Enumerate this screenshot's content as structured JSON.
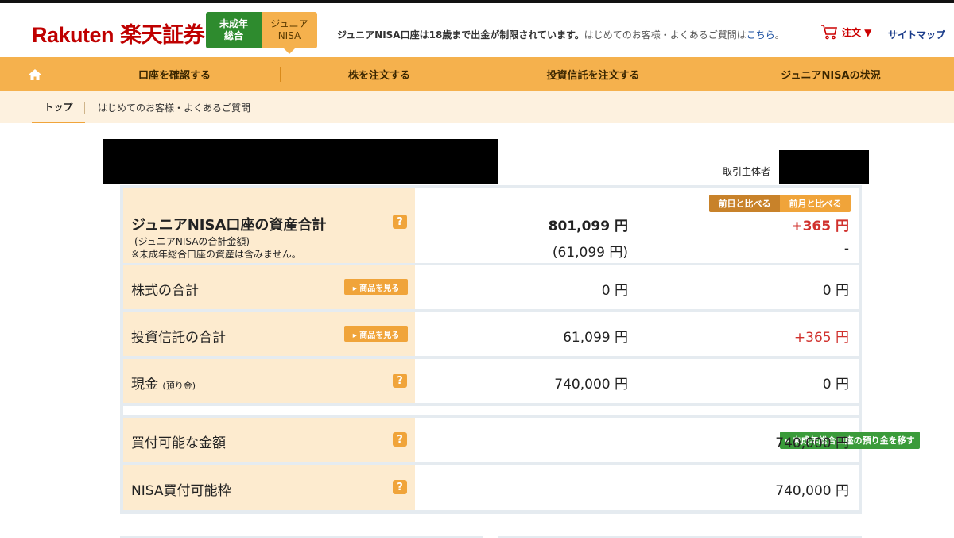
{
  "header": {
    "logo_en": "Rakuten",
    "logo_ja": "楽天証券",
    "tabs": [
      {
        "line1": "未成年",
        "line2": "総合"
      },
      {
        "line1": "ジュニア",
        "line2": "NISA"
      }
    ],
    "notice_bold": "ジュニアNISA口座は18歳まで出金が制限されています。",
    "notice_text": "はじめてのお客様・よくあるご質問は",
    "notice_link": "こちら",
    "notice_end": "。",
    "cart_label": "注文 ▼",
    "sitemap_label": "サイトマップ"
  },
  "nav": {
    "items": [
      "口座を確認する",
      "株を注文する",
      "投資信託を注文する",
      "ジュニアNISAの状況"
    ]
  },
  "subnav": {
    "top": "トップ",
    "faq": "はじめてのお客様・よくあるご質問"
  },
  "account": {
    "holder_label": "取引主体者"
  },
  "summary": {
    "title": "ジュニアNISA口座の資産合計",
    "note1": "(ジュニアNISAの合計金額)",
    "note2": "※未成年総合口座の資産は含みません。",
    "total": "801,099 円",
    "total_sub": "(61,099 円)",
    "compare_day": "前日と比べる",
    "compare_month": "前月と比べる",
    "diff": "+365 円",
    "diff_sub": "-"
  },
  "rows": [
    {
      "label": "株式の合計",
      "button": "▸ 商品を見る",
      "value": "0 円",
      "diff": "0 円"
    },
    {
      "label": "投資信託の合計",
      "button": "▸ 商品を見る",
      "value": "61,099 円",
      "diff": "+365 円"
    },
    {
      "label": "現金",
      "label_small": "(預り金)",
      "value": "740,000 円",
      "diff": "0 円"
    }
  ],
  "buying": {
    "label": "買付可能な金額",
    "transfer_button": "▸ 未成年総合口座の預り金を移す",
    "value": "740,000 円"
  },
  "nisa": {
    "label": "NISA買付可能枠",
    "value": "740,000 円"
  },
  "colors": {
    "brand_red": "#bf0000",
    "nav_orange": "#f5b14d",
    "label_bg": "#fdebcf",
    "positive_red": "#d0312d",
    "tab_green": "#2e8b2e"
  }
}
